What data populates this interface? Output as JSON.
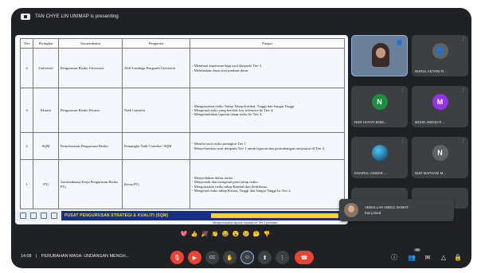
{
  "topbar": {
    "presenting_text": "TAN CHYE LIN UNIMAP is presenting"
  },
  "slide": {
    "headers": [
      "Tier",
      "Peringkat",
      "Jawatankuasa",
      "Pengerusi",
      "Fungsi"
    ],
    "rows": [
      {
        "tier": "4",
        "level": "Universiti",
        "committee": "Pengurusan Risiko Universiti",
        "chair": "Ahli Lembaga Pengarah Universiti",
        "functions": [
          "Membuat keputusan bagi usul daripada Tier 3.",
          "Meluluskan dasar atau pindaan dasar."
        ]
      },
      {
        "tier": "3",
        "level": "Kluster",
        "committee": "Pengurusan Risiko Kluster",
        "chair": "Naib Canselor",
        "functions": [
          "Menguruskan risiko Tahap Tahap Kritikal, Tinggi dan Sangat Tinggi",
          "Mengenal risiko yang bersifat low tolerance ke Tier 4.",
          "Mengemukakan laporan tahap risiko ke Tier 4."
        ]
      },
      {
        "tier": "2",
        "level": "SQM",
        "committee": "Penyelarasan Pengurusan Risiko",
        "chair": "Pemangku Naib Canselor/ SQM",
        "functions": [
          "Menilai usul risiko peringkat Tier 1.",
          "Menyelaraskan usul daripada Tier 1 untuk laporan dan pertimbangan mesyuarat di Tier 3."
        ]
      },
      {
        "tier": "1",
        "level": "PTj",
        "committee": "Jawatankuasa Kerja Pengurusan Risiko PTj",
        "chair": "Ketua PTj",
        "functions": [
          "Menyediakan daftar risiko.",
          "Menyemak dan mengenal pasti tahap risiko.",
          "Menguruskan risiko tahap Rendah dan Sederhana.",
          "Mengenal risiko tahap Ketara, Tinggi dan Sangat Tinggi ke Tier 2."
        ]
      }
    ],
    "banner_text": "PUSAT PENGURUSAN STRATEGI & KUALITI (SQM)",
    "banner_overlay_text": "Mengemukakan laporan kepada ke Tier 3 penilaian"
  },
  "participants": [
    {
      "name": "",
      "label": "self-video"
    },
    {
      "name": "NURUL ADYANI R...",
      "initial": "",
      "color": "#3c4043"
    },
    {
      "name": "NOR HAYATI BOM...",
      "initial": "N",
      "color": "#1e8e3e"
    },
    {
      "name": "MOHD ANDIDI R...",
      "initial": "M",
      "color": "#9334e6"
    },
    {
      "name": "KHAIRUL ANWAR ...",
      "initial": "",
      "color": "#1a5f7a"
    },
    {
      "name": "NUR MAPHANI M...",
      "initial": "N",
      "color": "#5f6368"
    }
  ],
  "toast": {
    "name": "ABDULLAH ABDUL SAMAT",
    "status": "has joined"
  },
  "reactions": [
    "💖",
    "👍",
    "🎉",
    "👏",
    "😂",
    "😮",
    "😢",
    "🤔",
    "👎"
  ],
  "bottombar": {
    "time": "14:08",
    "separator": "|",
    "meeting_title": "PERUBAHAN MASA: UNDANGAN MENGH...",
    "people_count": "45"
  },
  "icons": {
    "mic_off": "mic-off-icon",
    "cam_off": "camera-off-icon",
    "cc": "captions-icon",
    "hand": "raise-hand-icon",
    "present": "present-icon",
    "more": "more-options-icon",
    "leave": "leave-call-icon",
    "info": "info-icon",
    "people": "people-icon",
    "chat": "chat-icon",
    "activities": "activities-icon",
    "lock": "host-controls-icon"
  },
  "colors": {
    "background": "#202124",
    "tile": "#3c4043",
    "accent_blue": "#8ab4f8",
    "danger_red": "#ea4335",
    "banner_blue": "#1c2f86",
    "banner_yellow": "#ffd43b"
  }
}
